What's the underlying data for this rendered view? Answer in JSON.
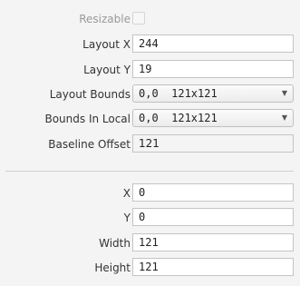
{
  "properties": {
    "resizable": {
      "label": "Resizable",
      "checked": false
    },
    "layout_x": {
      "label": "Layout X",
      "value": "244"
    },
    "layout_y": {
      "label": "Layout Y",
      "value": "19"
    },
    "layout_bounds": {
      "label": "Layout Bounds",
      "value": "0,0  121x121"
    },
    "bounds_in_local": {
      "label": "Bounds In Local",
      "value": "0,0  121x121"
    },
    "baseline_offset": {
      "label": "Baseline Offset",
      "value": "121"
    },
    "x": {
      "label": "X",
      "value": "0"
    },
    "y": {
      "label": "Y",
      "value": "0"
    },
    "width": {
      "label": "Width",
      "value": "121"
    },
    "height": {
      "label": "Height",
      "value": "121"
    }
  },
  "icons": {
    "dropdown": "chevron-down-icon"
  }
}
